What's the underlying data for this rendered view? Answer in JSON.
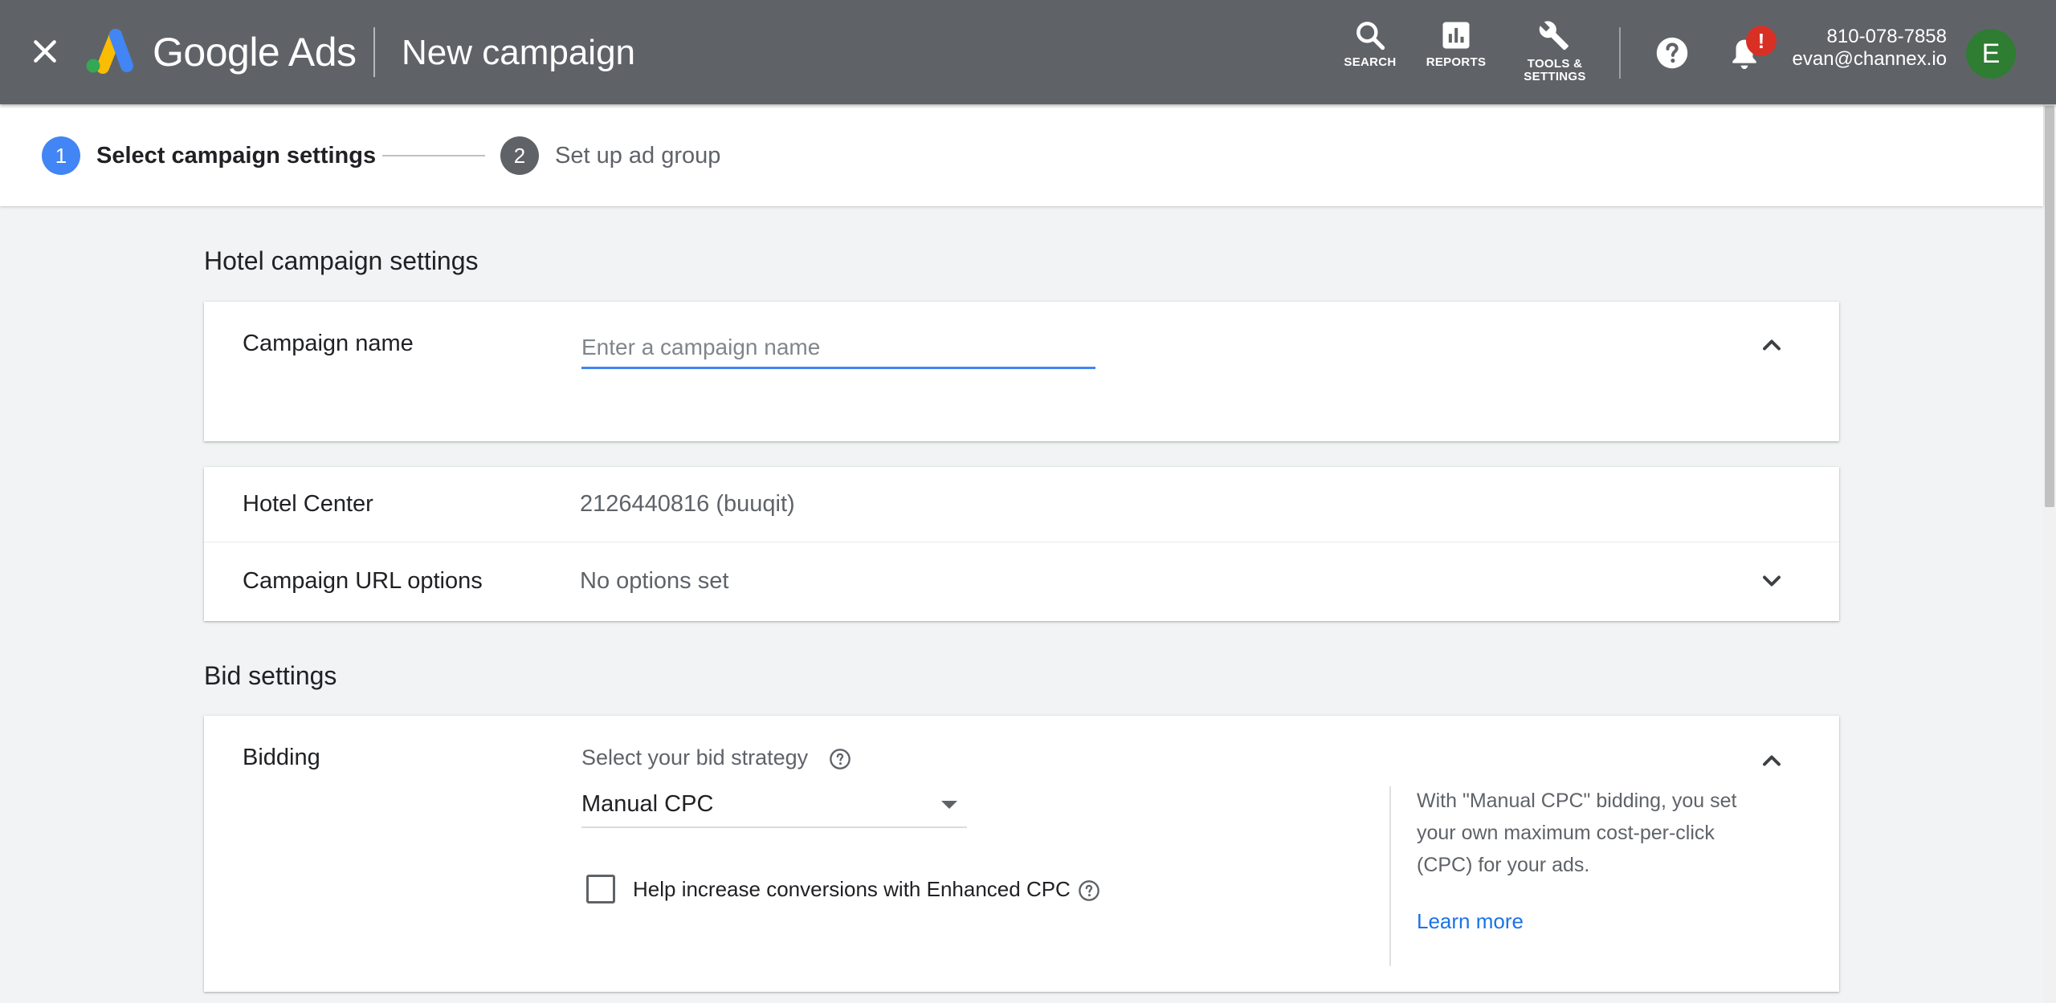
{
  "header": {
    "brand": "Google Ads",
    "page_title": "New campaign",
    "tools": {
      "search": "SEARCH",
      "reports": "REPORTS",
      "tools_line1": "TOOLS &",
      "tools_line2": "SETTINGS"
    },
    "notification_badge": "!",
    "account_phone": "810-078-7858",
    "account_email": "evan@channex.io",
    "avatar_letter": "E",
    "colors": {
      "bar": "#5f6368",
      "badge": "#d93025",
      "avatar": "#2e7d32"
    }
  },
  "stepper": {
    "steps": [
      {
        "number": "1",
        "label": "Select campaign settings",
        "state": "active"
      },
      {
        "number": "2",
        "label": "Set up ad group",
        "state": "inactive"
      }
    ],
    "colors": {
      "active": "#4285f4",
      "inactive": "#5f6368"
    }
  },
  "hotel_section": {
    "title": "Hotel campaign settings",
    "campaign_name": {
      "label": "Campaign name",
      "placeholder": "Enter a campaign name",
      "value": ""
    },
    "hotel_center": {
      "label": "Hotel Center",
      "value": "2126440816 (buuqit)"
    },
    "url_options": {
      "label": "Campaign URL options",
      "value": "No options set"
    }
  },
  "bid_section": {
    "title": "Bid settings",
    "bidding": {
      "label": "Bidding",
      "prompt": "Select your bid strategy",
      "selected_strategy": "Manual CPC",
      "ecpc_label": "Help increase conversions with Enhanced CPC",
      "ecpc_checked": false,
      "info_text": "With \"Manual CPC\" bidding, you set your own maximum cost-per-click (CPC) for your ads.",
      "learn_more": "Learn more"
    }
  },
  "accent_color": "#1a73e8"
}
